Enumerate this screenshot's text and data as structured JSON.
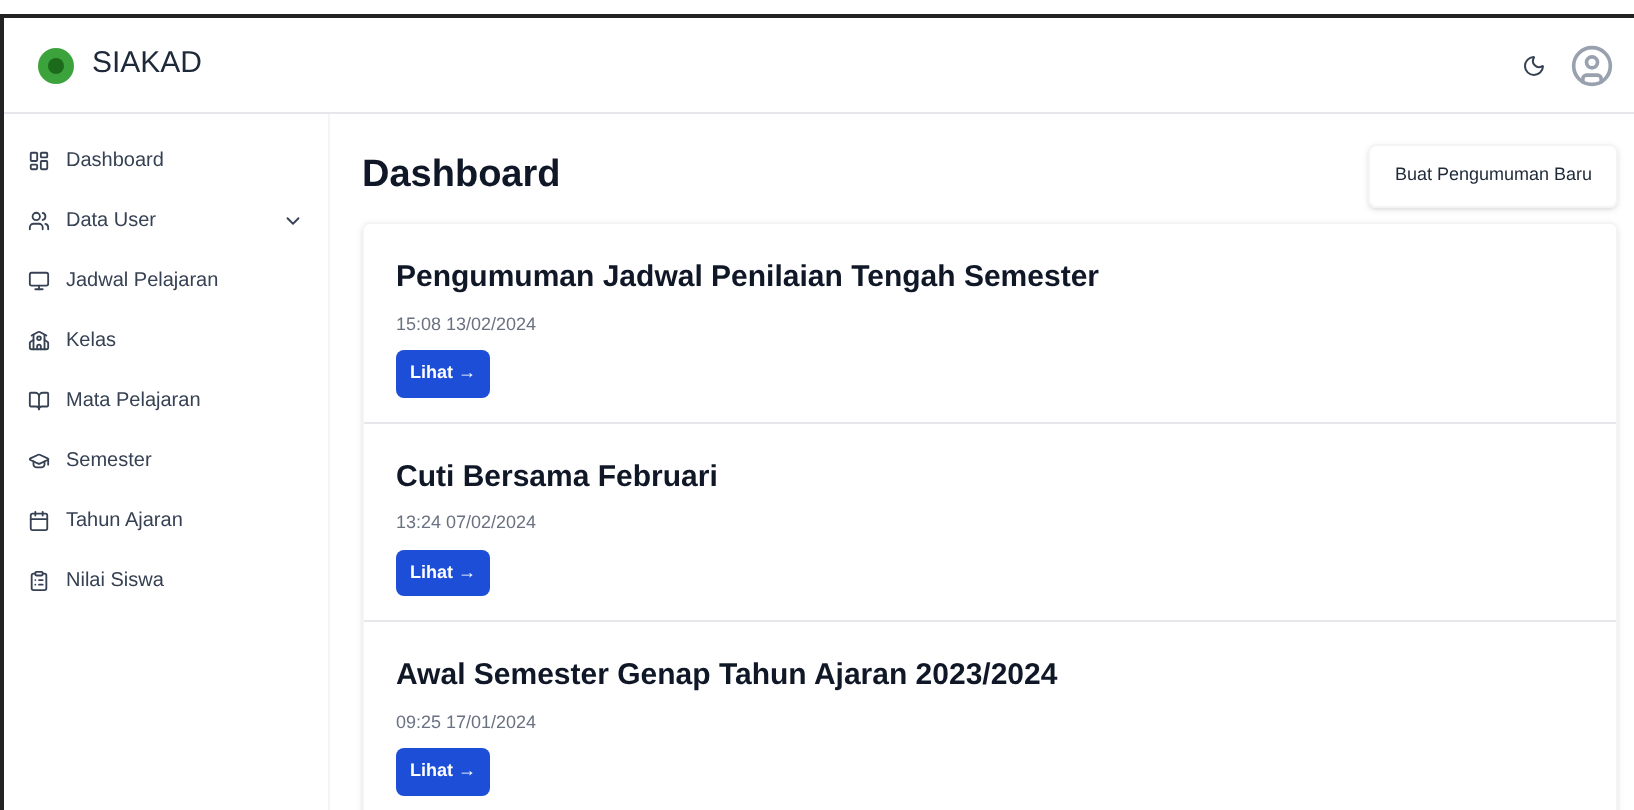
{
  "header": {
    "brand": "SIAKAD"
  },
  "sidebar": {
    "items": [
      {
        "label": "Dashboard",
        "kind": "dashboard"
      },
      {
        "label": "Data User",
        "kind": "users",
        "expanded": false
      },
      {
        "label": "Jadwal Pelajaran",
        "kind": "schedule"
      },
      {
        "label": "Kelas",
        "kind": "class"
      },
      {
        "label": "Mata Pelajaran",
        "kind": "subject"
      },
      {
        "label": "Semester",
        "kind": "semester"
      },
      {
        "label": "Tahun Ajaran",
        "kind": "year"
      },
      {
        "label": "Nilai Siswa",
        "kind": "grades"
      }
    ]
  },
  "page": {
    "title": "Dashboard",
    "action": "Buat Pengumuman Baru"
  },
  "announcements": [
    {
      "title": "Pengumuman Jadwal Penilaian Tengah Semester",
      "date": "15:08 13/02/2024",
      "button": "Lihat →"
    },
    {
      "title": "Cuti Bersama Februari",
      "date": "13:24 07/02/2024",
      "button": "Lihat →"
    },
    {
      "title": "Awal Semester Genap Tahun Ajaran 2023/2024",
      "date": "09:25 17/01/2024",
      "button": "Lihat →"
    }
  ]
}
